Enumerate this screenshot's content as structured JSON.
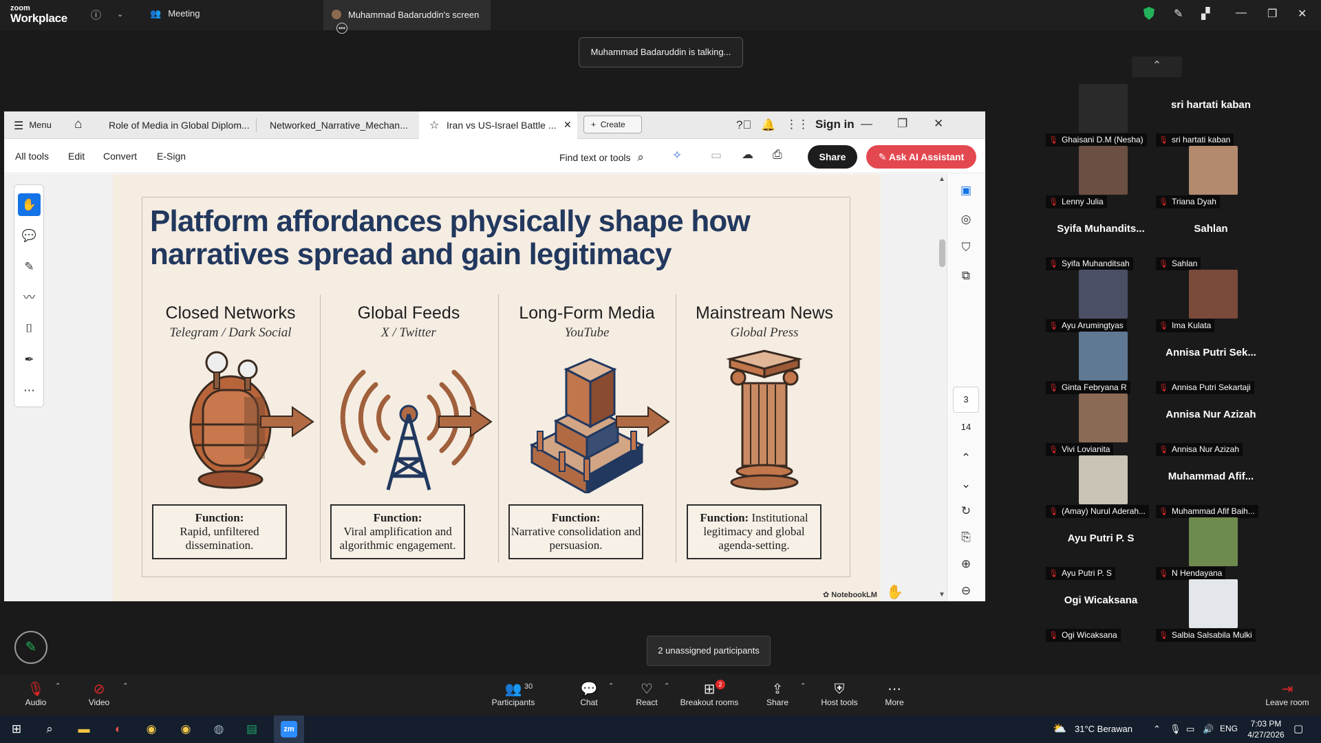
{
  "zoom": {
    "brand_top": "zoom",
    "brand_bottom": "Workplace",
    "meeting_label": "Meeting",
    "screen_tab_label": "Muhammad Badaruddin's screen",
    "talking_banner": "Muhammad Badaruddin is talking...",
    "unassigned_banner": "2 unassigned participants",
    "toolbar": {
      "audio": "Audio",
      "video": "Video",
      "participants": "Participants",
      "participants_count": "30",
      "chat": "Chat",
      "react": "React",
      "breakout": "Breakout rooms",
      "breakout_badge": "2",
      "share": "Share",
      "host_tools": "Host tools",
      "more": "More",
      "leave": "Leave room"
    }
  },
  "acrobat": {
    "menu_label": "Menu",
    "tabs": [
      "Role of Media in Global Diplom...",
      "Networked_Narrative_Mechan...",
      "Iran vs US-Israel Battle ..."
    ],
    "create_label": "Create",
    "sign_in": "Sign in",
    "menubar": [
      "All tools",
      "Edit",
      "Convert",
      "E-Sign"
    ],
    "find_label": "Find text or tools",
    "share_label": "Share",
    "ai_label": "Ask AI Assistant",
    "current_page": "3",
    "total_pages": "14"
  },
  "slide": {
    "title": "Platform affordances physically shape how narratives spread and gain legitimacy",
    "columns": [
      {
        "head": "Closed Networks",
        "sub": "Telegram / Dark Social",
        "fn_label": "Function:",
        "fn_text": "Rapid, unfiltered dissemination."
      },
      {
        "head": "Global Feeds",
        "sub": "X / Twitter",
        "fn_label": "Function:",
        "fn_text": "Viral amplification and algorithmic engagement."
      },
      {
        "head": "Long-Form Media",
        "sub": "YouTube",
        "fn_label": "Function:",
        "fn_text": "Narrative consolidation and persuasion."
      },
      {
        "head": "Mainstream News",
        "sub": "Global Press",
        "fn_label": "Function:",
        "fn_text": "Institutional legitimacy and global agenda-setting."
      }
    ],
    "watermark": "NotebookLM"
  },
  "participants": [
    {
      "display": "",
      "label": "Ghaisani D.M (Nesha)",
      "photo": true,
      "color": "#2a2a2a"
    },
    {
      "display": "sri hartati kaban",
      "label": "sri hartati kaban",
      "photo": false
    },
    {
      "display": "",
      "label": "Lenny Julia",
      "photo": true,
      "color": "#6b4f43"
    },
    {
      "display": "",
      "label": "Triana Dyah",
      "photo": true,
      "color": "#b48a6f"
    },
    {
      "display": "Syifa  Muhandits...",
      "label": "Syifa Muhanditsah",
      "photo": false
    },
    {
      "display": "Sahlan",
      "label": "Sahlan",
      "photo": false
    },
    {
      "display": "",
      "label": "Ayu Arumingtyas",
      "photo": true,
      "color": "#4a4f66"
    },
    {
      "display": "",
      "label": "Ima Kulata",
      "photo": true,
      "color": "#7a4a3b"
    },
    {
      "display": "",
      "label": "Ginta Febryana R",
      "photo": true,
      "color": "#5f7894"
    },
    {
      "display": "Annisa Putri Sek...",
      "label": "Annisa Putri Sekartaji",
      "photo": false
    },
    {
      "display": "",
      "label": "Vivi Lovianita",
      "photo": true,
      "color": "#8a6a55"
    },
    {
      "display": "Annisa Nur Azizah",
      "label": "Annisa Nur Azizah",
      "photo": false
    },
    {
      "display": "",
      "label": "(Amay) Nurul Aderah...",
      "photo": true,
      "color": "#c9c4b5"
    },
    {
      "display": "Muhammad  Afif...",
      "label": "Muhammad Afif Baih...",
      "photo": false
    },
    {
      "display": "Ayu Putri P. S",
      "label": "Ayu Putri P. S",
      "photo": false
    },
    {
      "display": "",
      "label": "N Hendayana",
      "photo": true,
      "color": "#6f8a4e"
    },
    {
      "display": "Ogi Wicaksana",
      "label": "Ogi Wicaksana",
      "photo": false
    },
    {
      "display": "",
      "label": "Salbia Salsabila Mulki",
      "photo": true,
      "color": "#e3e6ea"
    }
  ],
  "taskbar": {
    "weather": "31°C  Berawan",
    "lang": "ENG",
    "time": "7:03 PM",
    "date": "4/27/2026"
  }
}
